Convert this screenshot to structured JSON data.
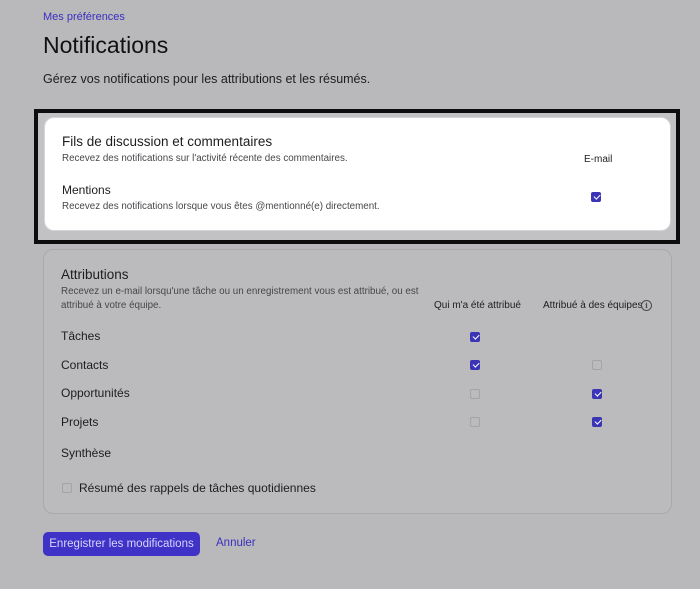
{
  "breadcrumb": "Mes préférences",
  "page": {
    "title": "Notifications",
    "subtitle": "Gérez vos notifications pour les attributions et les résumés."
  },
  "comments_section": {
    "title": "Fils de discussion et commentaires",
    "description": "Recevez des notifications sur l'activité récente des commentaires.",
    "column_header": "E-mail",
    "mentions": {
      "title": "Mentions",
      "description": "Recevez des notifications lorsque vous êtes @mentionné(e) directement.",
      "email_checked": true
    }
  },
  "attributions_section": {
    "title": "Attributions",
    "description_line1": "Recevez un e-mail lorsqu'une tâche ou un enregistrement vous est attribué, ou est",
    "description_line2": "attribué à votre équipe.",
    "column_assigned_to_me": "Qui m'a été attribué",
    "column_assigned_to_teams": "Attribué à des équipes",
    "info_icon": "info-icon",
    "rows": [
      {
        "label": "Tâches",
        "assigned_to_me": true,
        "assigned_to_teams": null
      },
      {
        "label": "Contacts",
        "assigned_to_me": true,
        "assigned_to_teams": false
      },
      {
        "label": "Opportunités",
        "assigned_to_me": false,
        "assigned_to_teams": true
      },
      {
        "label": "Projets",
        "assigned_to_me": false,
        "assigned_to_teams": true
      }
    ],
    "summary_title": "Synthèse",
    "summary_item": {
      "label": "Résumé des rappels de tâches quotidiennes",
      "checked": false
    }
  },
  "actions": {
    "save_label": "Enregistrer les modifications",
    "cancel_label": "Annuler"
  },
  "colors": {
    "accent": "#3e33c6",
    "background": "#b9b9bb",
    "card": "#ffffff",
    "highlight_border": "#0d0d0d"
  }
}
